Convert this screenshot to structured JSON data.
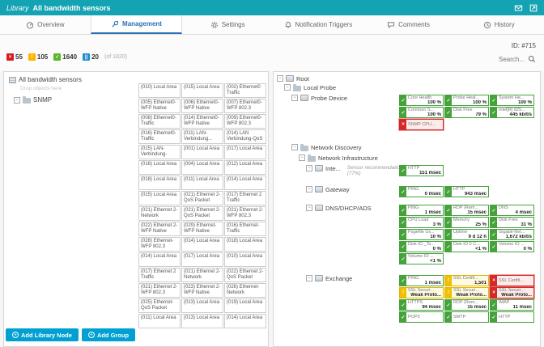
{
  "header": {
    "app": "Library",
    "title": "All bandwidth sensors"
  },
  "tabs": [
    {
      "label": "Overview",
      "active": false
    },
    {
      "label": "Management",
      "active": true
    },
    {
      "label": "Settings",
      "active": false
    },
    {
      "label": "Notification Triggers",
      "active": false
    },
    {
      "label": "Comments",
      "active": false
    },
    {
      "label": "History",
      "active": false
    }
  ],
  "toolbar": {
    "counts": [
      {
        "value": "55",
        "status": "down",
        "color": "#d71e1e"
      },
      {
        "value": "105",
        "status": "warning",
        "color": "#ffb300"
      },
      {
        "value": "1640",
        "status": "up",
        "color": "#5cb52a"
      },
      {
        "value": "20",
        "status": "paused",
        "color": "#1f8fd0"
      }
    ],
    "total": "(of 1820)",
    "id_label": "ID: #715",
    "search_placeholder": "Search..."
  },
  "library": {
    "root_label": "All bandwidth sensors",
    "drop_hint": "Drop objects here",
    "node_label": "SNMP",
    "items": [
      "(010) Local Area",
      "(015) Local Area",
      "(002) Ethernet0 Traffic",
      "(005) Ethernet0-WFP Native",
      "(006) Ethernet0-WFP Native",
      "(007) Ethernet0-WFP 802.3",
      "(008) Ethernet0-Traffic",
      "(014) Ethernet0-WFP Native",
      "(009) Ethernet0-WFP 802.3",
      "(016) Ethernet0-Traffic",
      "(011) LAN-Verbindung...",
      "(014) LAN Verbindung-QoS",
      "(015) LAN-Verbindung-",
      "(001) Local Area",
      "(017) Local Area",
      "(016) Local Area",
      "(004) Local Area",
      "(012) Local Area",
      "(018) Local Area",
      "(011) Local Area",
      "(014) Local Area",
      "(015) Local Area",
      "(021) Ethernet 2-QoS Packet",
      "(017) Ethernet 2 Traffic",
      "(021) Ethernet 2-Network",
      "(021) Ethernet 2-QoS Packet",
      "(021) Ethernet 2-WFP 802.3",
      "(022) Ethernet 2-WFP Native",
      "(029) Ethernet-WFP Native",
      "(016) Ethernet-Traffic",
      "(028) Ethernet-WFP 802.3",
      "(014) Local Area",
      "(018) Local Area",
      "(014) Local Area",
      "(017) Local Area",
      "(010) Local Area",
      "(017) Ethernet 2 Traffic",
      "(021) Ethernet 2-Network",
      "(022) Ethernet 2-QoS Packet",
      "(021) Ethernet 2-WFP 802.3",
      "(023) Ethernet 2-WFP Native",
      "(026) Ethernet-Network",
      "(025) Ethernet-QoS Packet",
      "(013) Local Area",
      "(019) Local Area",
      "(011) Local Area",
      "(013) Local Area",
      "(014) Local Area"
    ]
  },
  "device_tree": {
    "nodes": [
      {
        "name": "Root",
        "type": "root",
        "indent": 0,
        "chip_rows": null
      },
      {
        "name": "Local Probe",
        "type": "group",
        "indent": 1,
        "chip_rows": null
      },
      {
        "name": "Probe Device",
        "type": "device",
        "indent": 2,
        "chip_rows": [
          [
            {
              "name": "Core Health",
              "value": "100 %",
              "status": "up"
            },
            {
              "name": "Probe Heal...",
              "value": "100 %",
              "status": "up"
            },
            {
              "name": "System He...",
              "value": "100 %",
              "status": "up"
            }
          ],
          [
            {
              "name": "Common S...",
              "value": "100 %",
              "status": "up"
            },
            {
              "name": "Disk Free",
              "value": "79 %",
              "status": "up"
            },
            {
              "name": "Intel[R] 825...",
              "value": "445 kbit/s",
              "status": "up"
            }
          ],
          [
            {
              "name": "SNMP CPU...",
              "value": "",
              "status": "down"
            }
          ]
        ]
      },
      {
        "name": "Network Discovery",
        "type": "group",
        "indent": 2,
        "chip_rows": null
      },
      {
        "name": "Network Infrastructure",
        "type": "group",
        "indent": 3,
        "chip_rows": null
      },
      {
        "name": "Inte...",
        "type": "device",
        "indent": 4,
        "note": "Sensor recommendation in progress (77%)",
        "chip_rows": [
          [
            {
              "name": "HTTP",
              "value": "151 msec",
              "status": "up"
            }
          ]
        ]
      },
      {
        "name": "Gateway",
        "type": "device",
        "indent": 4,
        "chip_rows": [
          [
            {
              "name": "PING",
              "value": "0 msec",
              "status": "up"
            },
            {
              "name": "HTTP",
              "value": "943 msec",
              "status": "up"
            }
          ]
        ]
      },
      {
        "name": "DNS/DHCP/ADS",
        "type": "device",
        "indent": 4,
        "chip_rows": [
          [
            {
              "name": "PING",
              "value": "1 msec",
              "status": "up"
            },
            {
              "name": "RDP (Rem...",
              "value": "15 msec",
              "status": "up"
            },
            {
              "name": "DNS",
              "value": "4 msec",
              "status": "up"
            }
          ],
          [
            {
              "name": "CPU Load",
              "value": "3 %",
              "status": "up"
            },
            {
              "name": "Memory",
              "value": "25 %",
              "status": "up"
            },
            {
              "name": "Disk Free",
              "value": "31 %",
              "status": "up"
            }
          ],
          [
            {
              "name": "Pagefile Us...",
              "value": "10 %",
              "status": "up"
            },
            {
              "name": "Uptime",
              "value": "9 d 12 h",
              "status": "up"
            },
            {
              "name": "Gigabit-Net...",
              "value": "1,672 kbit/s",
              "status": "up"
            }
          ],
          [
            {
              "name": "Disk IO _To...",
              "value": "0 %",
              "status": "up"
            },
            {
              "name": "Disk IO 0 C...",
              "value": "<1 %",
              "status": "up"
            },
            {
              "name": "Volume IO ...",
              "value": "0 %",
              "status": "up"
            }
          ],
          [
            {
              "name": "Volume IO ...",
              "value": "<1 %",
              "status": "up"
            }
          ]
        ]
      },
      {
        "name": "Exchange",
        "type": "device",
        "indent": 4,
        "chip_rows": [
          [
            {
              "name": "PING",
              "value": "1 msec",
              "status": "up"
            },
            {
              "name": "SSL Certifi...",
              "value": "1,501",
              "status": "warn"
            },
            {
              "name": "SSL Certifi...",
              "value": "",
              "status": "down"
            }
          ],
          [
            {
              "name": "SSL Securi...",
              "value": "Weak Proto...",
              "status": "warn"
            },
            {
              "name": "SSL Securi...",
              "value": "Weak Proto...",
              "status": "warn"
            },
            {
              "name": "SSL Securi...",
              "value": "Weak Proto...",
              "status": "down"
            }
          ],
          [
            {
              "name": "HTTPS",
              "value": "94 msec",
              "status": "up"
            },
            {
              "name": "RDP (Rem...",
              "value": "15 msec",
              "status": "up"
            },
            {
              "name": "IMAP",
              "value": "11 msec",
              "status": "up"
            }
          ],
          [
            {
              "name": "POP3",
              "value": "",
              "status": "up"
            },
            {
              "name": "SMTP",
              "value": "",
              "status": "up"
            },
            {
              "name": "HTTP",
              "value": "",
              "status": "up"
            }
          ]
        ]
      }
    ]
  },
  "footer": {
    "buttons": [
      {
        "label": "Add Library Node"
      },
      {
        "label": "Add Group"
      }
    ]
  },
  "colors": {
    "header_teal": "#13a3b2",
    "active_tab_blue": "#2d6fb5",
    "sensor_up": "#46a33c",
    "sensor_warning": "#f0c000",
    "sensor_down": "#d62828",
    "paused_blue": "#1f8fd0",
    "button_cyan": "#00a0d2"
  }
}
